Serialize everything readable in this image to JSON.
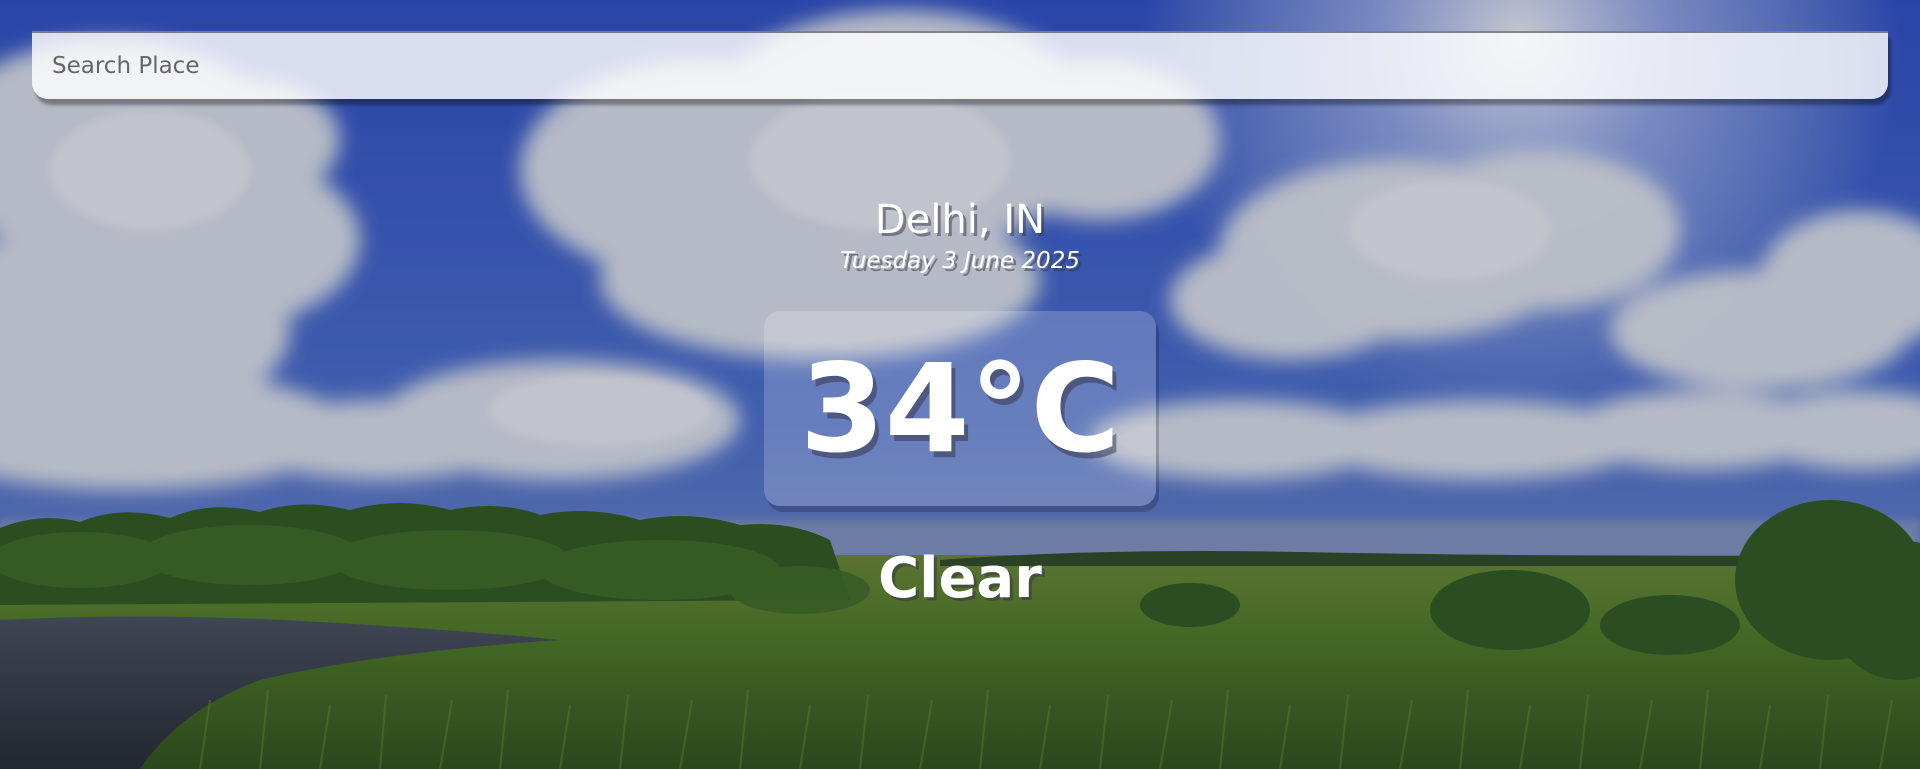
{
  "search": {
    "placeholder": "Search Place",
    "value": ""
  },
  "location": {
    "city_country": "Delhi, IN",
    "date": "Tuesday 3 June 2025"
  },
  "weather": {
    "temperature": "34°C",
    "condition": "Clear"
  },
  "background": {
    "scene": "cloudy sky over green meadow with river",
    "sky_color": "#3b63c8",
    "cloud_color": "#e8ebef",
    "grass_color": "#3d6b1e",
    "water_color": "#2d3440"
  }
}
